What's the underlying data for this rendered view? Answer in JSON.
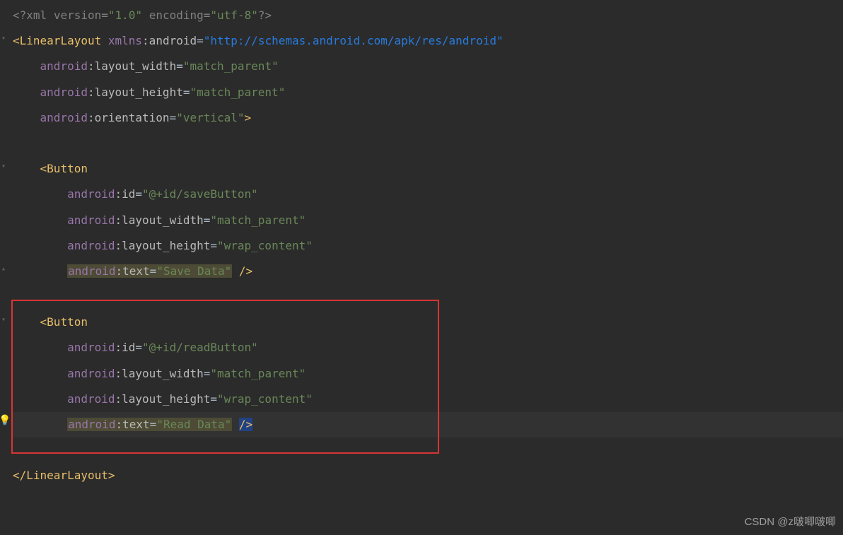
{
  "xml_decl": {
    "open": "<?",
    "name": "xml",
    "attrs": [
      {
        "n": "version",
        "v": "\"1.0\""
      },
      {
        "n": "encoding",
        "v": "\"utf-8\""
      }
    ],
    "close": "?>"
  },
  "root": {
    "open": "<",
    "name": "LinearLayout",
    "xmlns_ns": "xmlns",
    "xmlns_attr": ":android",
    "xmlns_val": "\"http://schemas.android.com/apk/res/android\"",
    "attrs": [
      {
        "ns": "android",
        "n": ":layout_width",
        "v": "\"match_parent\""
      },
      {
        "ns": "android",
        "n": ":layout_height",
        "v": "\"match_parent\""
      },
      {
        "ns": "android",
        "n": ":orientation",
        "v": "\"vertical\"",
        "end": ">"
      }
    ],
    "close_open": "</",
    "close_name": "LinearLayout",
    "close_end": ">"
  },
  "button1": {
    "open": "<",
    "name": "Button",
    "attrs": [
      {
        "ns": "android",
        "n": ":id",
        "v": "\"@+id/saveButton\""
      },
      {
        "ns": "android",
        "n": ":layout_width",
        "v": "\"match_parent\""
      },
      {
        "ns": "android",
        "n": ":layout_height",
        "v": "\"wrap_content\""
      },
      {
        "ns": "android",
        "n": ":text",
        "v": "\"Save Data\"",
        "hl": true,
        "end": " />"
      }
    ]
  },
  "button2": {
    "open": "<",
    "name": "Button",
    "attrs": [
      {
        "ns": "android",
        "n": ":id",
        "v": "\"@+id/readButton\""
      },
      {
        "ns": "android",
        "n": ":layout_width",
        "v": "\"match_parent\""
      },
      {
        "ns": "android",
        "n": ":layout_height",
        "v": "\"wrap_content\""
      },
      {
        "ns": "android",
        "n": ":text",
        "v": "\"Read Data\"",
        "hl": true,
        "end": "/>",
        "cursor": true
      }
    ]
  },
  "watermark": "CSDN @z啵唧啵唧"
}
